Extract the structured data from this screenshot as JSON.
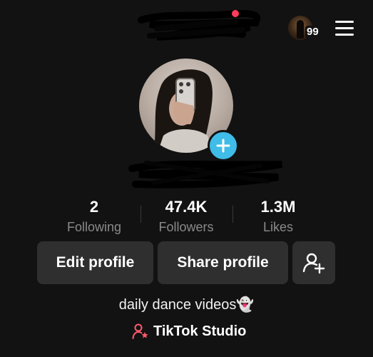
{
  "header": {
    "badge_count": "99",
    "notification_color": "#ff3b5c"
  },
  "profile": {
    "add_icon_color": "#3fbce7",
    "bio": "daily dance videos👻"
  },
  "stats": [
    {
      "value": "2",
      "label": "Following"
    },
    {
      "value": "47.4K",
      "label": "Followers"
    },
    {
      "value": "1.3M",
      "label": "Likes"
    }
  ],
  "actions": {
    "edit_label": "Edit profile",
    "share_label": "Share profile",
    "add_friend_icon": "add-user-icon"
  },
  "studio": {
    "label": "TikTok Studio",
    "icon": "person-star-icon",
    "icon_color": "#ff5a6e"
  }
}
